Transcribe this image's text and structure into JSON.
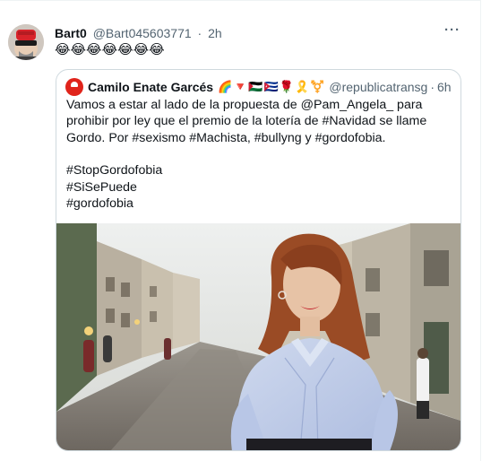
{
  "tweet": {
    "display_name": "Bart0",
    "handle": "@Bart045603771",
    "separator": "·",
    "time": "2h",
    "text_emojis": "😂😂😂😂😂😂😂",
    "more_icon": "ellipsis-icon"
  },
  "quoted_tweet": {
    "display_name": "Camilo Enate Garcés",
    "name_emojis": "🌈🔻🇵🇸🇨🇺🌹🎗️⚧️",
    "handle": "@republicatransg",
    "separator": "·",
    "time": "6h",
    "body_line1": "Vamos a estar al lado de la propuesta de @Pam_Angela_ para prohibir por ley que el premio de la lotería de #Navidad se llame Gordo. Por #sexismo #Machista, #bullyng y #gordofobia.",
    "hashtag1": "#StopGordofobia",
    "hashtag2": "#SiSePuede",
    "hashtag3": "#gordofobia"
  },
  "colors": {
    "text": "#0f1419",
    "secondary": "#536471",
    "border": "#cfd9de",
    "quote_avatar": "#e0241b"
  }
}
